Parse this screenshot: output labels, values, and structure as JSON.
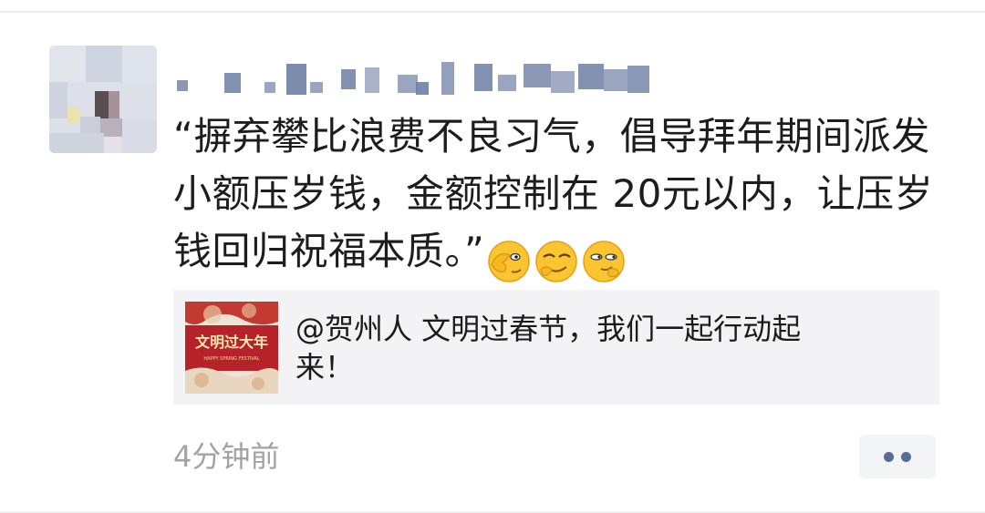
{
  "moment": {
    "post_text": "“摒弃攀比浪费不良习气，倡导拜年期间派发小额压岁钱，金额控制在 20元以内，让压岁钱回归祝福本质。”",
    "emojis": [
      "facepalm-emoji",
      "smirk-emoji",
      "sly-emoji"
    ],
    "link_card": {
      "title": "@贺州人 文明过春节，我们一起行动起来！",
      "thumbnail": {
        "title": "文明过大年",
        "subtitle": "HAPPY SPRING FESTIVAL"
      }
    },
    "timestamp": "4分钟前",
    "more_icon": "more-dots-icon"
  },
  "colors": {
    "link_blue": "#576b95",
    "text_dark": "#1d1d1d",
    "timestamp_gray": "#a3a3a3",
    "card_bg": "#f3f3f5"
  }
}
